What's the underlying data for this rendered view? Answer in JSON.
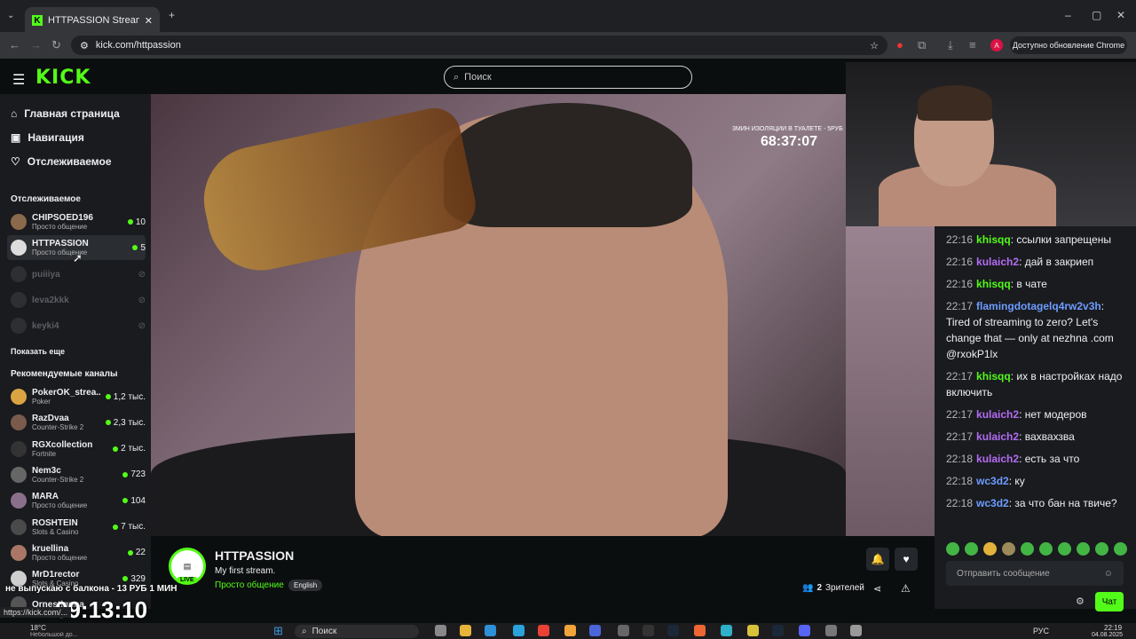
{
  "browser": {
    "tab_title": "HTTPASSION Stream - Wat",
    "url": "kick.com/httpassion",
    "update_label": "Доступно обновление Chrome",
    "status_url": "https://kick.com/..."
  },
  "header": {
    "logo": "KICK",
    "search_placeholder": "Поиск"
  },
  "sidebar": {
    "nav": [
      {
        "label": "Главная страница",
        "icon": "home-icon"
      },
      {
        "label": "Навигация",
        "icon": "compass-icon"
      },
      {
        "label": "Отслеживаемое",
        "icon": "heart-icon"
      }
    ],
    "following_heading": "Отслеживаемое",
    "following": [
      {
        "name": "CHIPSOED196",
        "category": "Просто общение",
        "viewers": "10",
        "live": true
      },
      {
        "name": "HTTPASSION",
        "category": "Просто общение",
        "viewers": "5",
        "live": true
      },
      {
        "name": "puiiiya",
        "category": "",
        "viewers": "",
        "live": false
      },
      {
        "name": "leva2kkk",
        "category": "",
        "viewers": "",
        "live": false
      },
      {
        "name": "keyki4",
        "category": "",
        "viewers": "",
        "live": false
      }
    ],
    "show_more": "Показать еще",
    "recommended_heading": "Рекомендуемые каналы",
    "recommended": [
      {
        "name": "PokerOK_strea...",
        "category": "Poker",
        "viewers": "1,2 тыс."
      },
      {
        "name": "RazDvaa",
        "category": "Counter-Strike 2",
        "viewers": "2,3 тыс."
      },
      {
        "name": "RGXcollection",
        "category": "Fortnite",
        "viewers": "2 тыс."
      },
      {
        "name": "Nem3c",
        "category": "Counter-Strike 2",
        "viewers": "723"
      },
      {
        "name": "MARA",
        "category": "Просто общение",
        "viewers": "104"
      },
      {
        "name": "ROSHTEIN",
        "category": "Slots & Casino",
        "viewers": "7 тыс."
      },
      {
        "name": "kruellina",
        "category": "Просто общение",
        "viewers": "22"
      },
      {
        "name": "MrD1rector",
        "category": "Slots & Casino",
        "viewers": "329"
      },
      {
        "name": "Ornestiquna",
        "category": "",
        "viewers": ""
      }
    ]
  },
  "video": {
    "overlay_caption": "3МИН ИЗОЛЯЦИИ В ТУАЛЕТЕ - 5РУБ",
    "overlay_timer": "68:37:07"
  },
  "stream": {
    "channel": "HTTPASSION",
    "title": "My first stream.",
    "category": "Просто общение",
    "language": "English",
    "live_badge": "LIVE",
    "viewers_count": "2",
    "viewers_label": "Зрителей"
  },
  "chat": {
    "messages": [
      {
        "time": "22:16",
        "user": "khisqq",
        "color": "#53fc18",
        "text": "ссылки запрещены"
      },
      {
        "time": "22:16",
        "user": "kulaich2",
        "color": "#b56cf2",
        "text": "дай в закриеп"
      },
      {
        "time": "22:16",
        "user": "khisqq",
        "color": "#53fc18",
        "text": "в чате"
      },
      {
        "time": "22:17",
        "user": "flamingdotagelq4rw2v3h",
        "color": "#6e9cff",
        "text": "Tired of streaming to zero? Let's change that — only at nezhna .com @rxokP1lx"
      },
      {
        "time": "22:17",
        "user": "khisqq",
        "color": "#53fc18",
        "text": "их в настройках надо включить"
      },
      {
        "time": "22:17",
        "user": "kulaich2",
        "color": "#b56cf2",
        "text": "нет модеров"
      },
      {
        "time": "22:17",
        "user": "kulaich2",
        "color": "#b56cf2",
        "text": "вахвахзва"
      },
      {
        "time": "22:18",
        "user": "kulaich2",
        "color": "#b56cf2",
        "text": "есть за что"
      },
      {
        "time": "22:18",
        "user": "wc3d2",
        "color": "#6e9cff",
        "text": "ку"
      },
      {
        "time": "22:18",
        "user": "wc3d2",
        "color": "#6e9cff",
        "text": "за что бан на твиче?"
      }
    ],
    "input_placeholder": "Отправить сообщение",
    "send_label": "Чат"
  },
  "overlay": {
    "banner_text": "не выпускаю с балкона - 13 РУБ 1 МИН",
    "timer": "09:13:10"
  },
  "taskbar": {
    "weather_temp": "18°C",
    "weather_desc": "Небольшой до...",
    "search_label": "Поиск",
    "lang": "РУС",
    "time": "22:19",
    "date": "04.08.2025"
  },
  "colors": {
    "accent": "#53fc18",
    "bg": "#0b0e0f",
    "panel": "#191b1f"
  }
}
